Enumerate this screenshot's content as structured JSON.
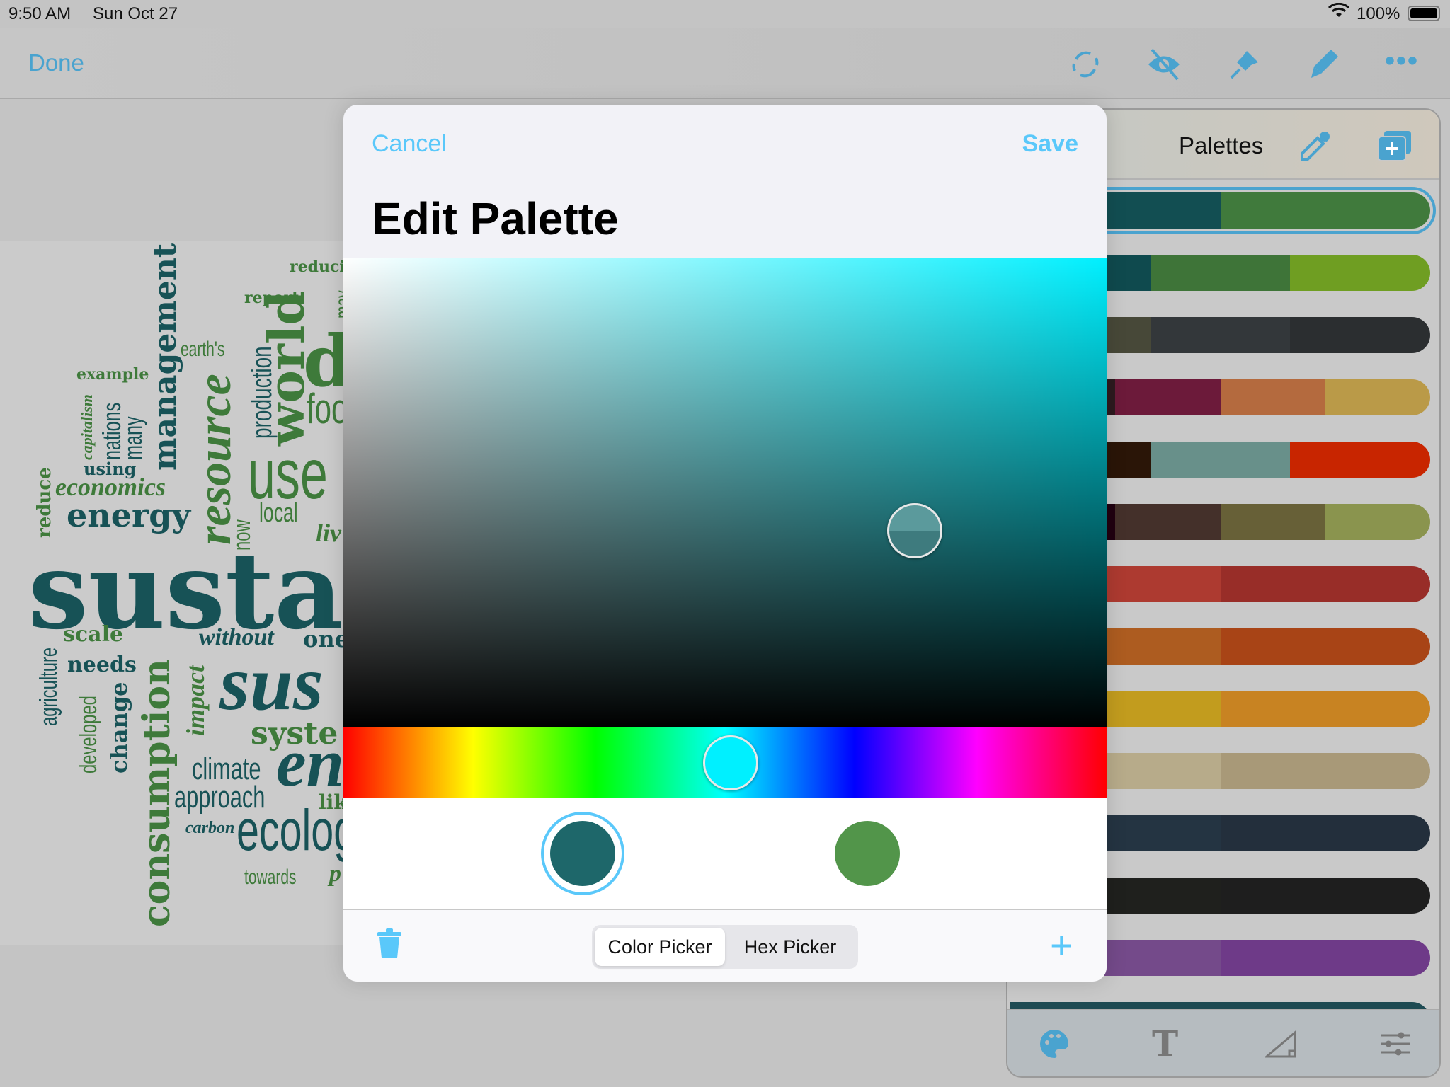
{
  "status_bar": {
    "time": "9:50 AM",
    "date": "Sun Oct 27",
    "battery": "100%"
  },
  "toolbar": {
    "done_label": "Done",
    "icons": [
      "rotate-icon",
      "eye-slash-icon",
      "pin-icon",
      "pen-icon",
      "more-icon"
    ]
  },
  "word_cloud": {
    "words": [
      "reduci",
      "report",
      "may",
      "earth's",
      "example",
      "management",
      "world",
      "production",
      "d",
      "foo",
      "capitalism",
      "nations",
      "many",
      "resource",
      "use",
      "using",
      "reduce",
      "economics",
      "energy",
      "local",
      "now",
      "liv",
      "susta",
      "agriculture",
      "scale",
      "consumption",
      "without",
      "one",
      "needs",
      "sus",
      "impact",
      "developed",
      "change",
      "syste",
      "climate",
      "en",
      "approach",
      "lik",
      "carbon",
      "ecolog",
      "towards",
      "p"
    ]
  },
  "palettes_panel": {
    "title": "Palettes",
    "selected_index": 0,
    "rows": [
      [
        "#124e52",
        "#407a3c"
      ],
      [
        "#0f4a4e",
        "#3e7438",
        "#6f9e22"
      ],
      [
        "#474838",
        "#33373a",
        "#2b2e30"
      ],
      [
        "#2d1a1f",
        "#6c1a3a",
        "#b46a3e",
        "#ba9a48"
      ],
      [
        "#2a1507",
        "#68908a",
        "#c82500"
      ],
      [
        "#200010",
        "#44302a",
        "#676037",
        "#8a944e"
      ],
      [
        "#ad3a30",
        "#982d28"
      ],
      [
        "#ad5c20",
        "#a84416"
      ],
      [
        "#c29c1e",
        "#c88322"
      ],
      [
        "#b7ab8a",
        "#a89978"
      ],
      [
        "#243442",
        "#232f3c"
      ],
      [
        "#1f201d",
        "#1e1e1e"
      ],
      [
        "#744a8a",
        "#6e3a88"
      ],
      [
        "#1e4a52",
        "#1e4a52"
      ]
    ]
  },
  "modal": {
    "cancel_label": "Cancel",
    "save_label": "Save",
    "title": "Edit Palette",
    "hue_color": "#00f0ff",
    "swatches": [
      {
        "color": "#1e676a",
        "selected": true
      },
      {
        "color": "#52954a",
        "selected": false
      }
    ],
    "segments": [
      "Color Picker",
      "Hex Picker"
    ],
    "active_segment": "Color Picker"
  }
}
